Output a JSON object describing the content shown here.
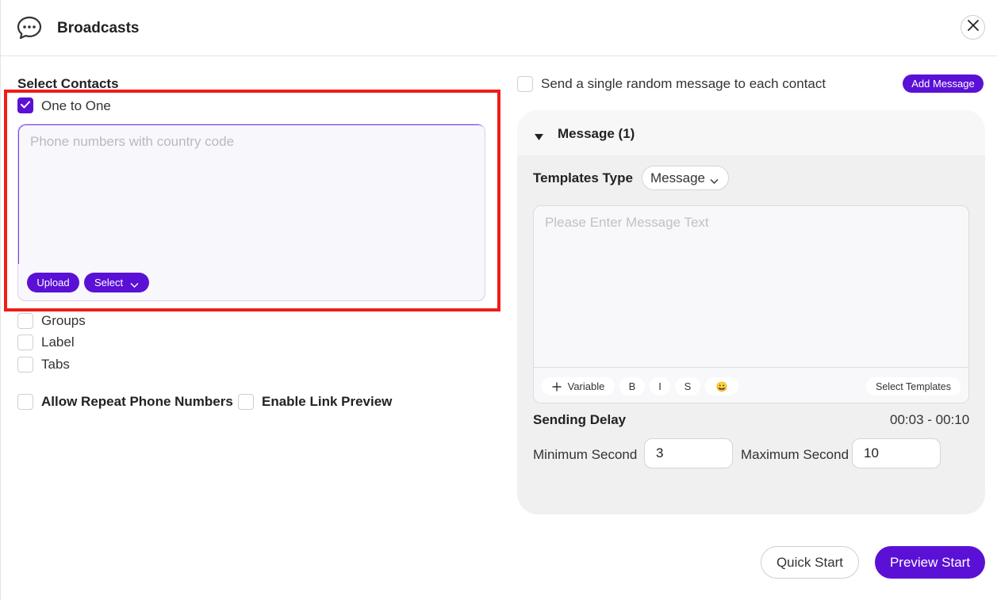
{
  "header": {
    "title": "Broadcasts",
    "icon": "chat-bubble-icon",
    "close_icon": "close-icon"
  },
  "contacts": {
    "section_title": "Select Contacts",
    "options": [
      {
        "label": "One to One",
        "checked": true
      },
      {
        "label": "Groups",
        "checked": false
      },
      {
        "label": "Label",
        "checked": false
      },
      {
        "label": "Tabs",
        "checked": false
      }
    ],
    "phone_placeholder": "Phone numbers with country code",
    "upload_label": "Upload",
    "select_label": "Select",
    "allow_repeat_label": "Allow Repeat Phone Numbers",
    "enable_link_preview_label": "Enable Link Preview"
  },
  "message_settings": {
    "random_message_label": "Send a single random message to each contact",
    "add_message_label": "Add Message",
    "message_title": "Message (1)",
    "templates_type_label": "Templates Type",
    "templates_type_value": "Message",
    "message_placeholder": "Please Enter Message Text",
    "toolbar": {
      "variable_label": "Variable",
      "bold_label": "B",
      "italic_label": "I",
      "strike_label": "S",
      "emoji": "😀",
      "select_templates_label": "Select Templates"
    },
    "sending_delay_label": "Sending Delay",
    "sending_delay_range": "00:03 - 00:10",
    "min_second_label": "Minimum Second",
    "min_second_value": "3",
    "max_second_label": "Maximum Second",
    "max_second_value": "10"
  },
  "footer": {
    "quick_start_label": "Quick Start",
    "preview_start_label": "Preview Start"
  },
  "colors": {
    "accent": "#5b10d6",
    "highlight": "#ef1c1c",
    "panel_bg": "#f0f0f0"
  }
}
